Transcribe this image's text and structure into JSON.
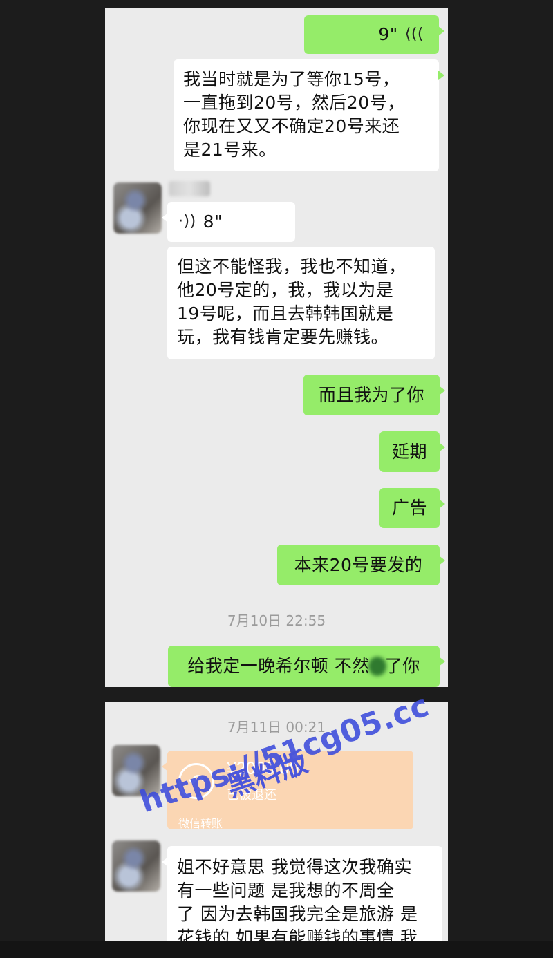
{
  "conversation_1": {
    "voice_out": {
      "duration": "9\"",
      "icon": "voice-wave-icon"
    },
    "out_message_1": [
      "我当时就是为了等你15号，",
      "一直拖到20号，然后20号，",
      "你现在又又不确定20号来还",
      "是21号来。"
    ],
    "voice_in": {
      "duration": "8\"",
      "icon": "voice-wave-icon"
    },
    "in_message_1": [
      "但这不能怪我，我也不知道，",
      "他20号定的，我，我以为是",
      "19号呢，而且去韩韩国就是",
      "玩，我有钱肯定要先赚钱。"
    ],
    "out_message_2": "而且我为了你",
    "out_message_3": "延期",
    "out_message_4": "广告",
    "out_message_5": "本来20号要发的",
    "timestamp": "7月10日 22:55",
    "out_message_6_part1": "给我定一晚希尔顿 不然",
    "out_message_6_part2": "了你"
  },
  "conversation_2": {
    "timestamp": "7月11日 00:21",
    "transfer": {
      "amount": "¥2000.00",
      "status": "已被退还",
      "label": "微信转账",
      "icon": "return-arrow-icon",
      "color": "#fbd6b3"
    },
    "in_message": [
      "姐不好意思 我觉得这次我确实",
      "有一些问题 是我想的不周全",
      "了 因为去韩国我完全是旅游 是",
      "花钱的 如果有能赚钱的事情 我"
    ]
  },
  "watermark": {
    "url": "https://51cg05.cc",
    "subtitle": "黑料版"
  },
  "colors": {
    "outgoing_bubble": "#95ec69",
    "incoming_bubble": "#ffffff",
    "chat_background": "#ebebeb",
    "page_background": "#1c1c1c"
  }
}
